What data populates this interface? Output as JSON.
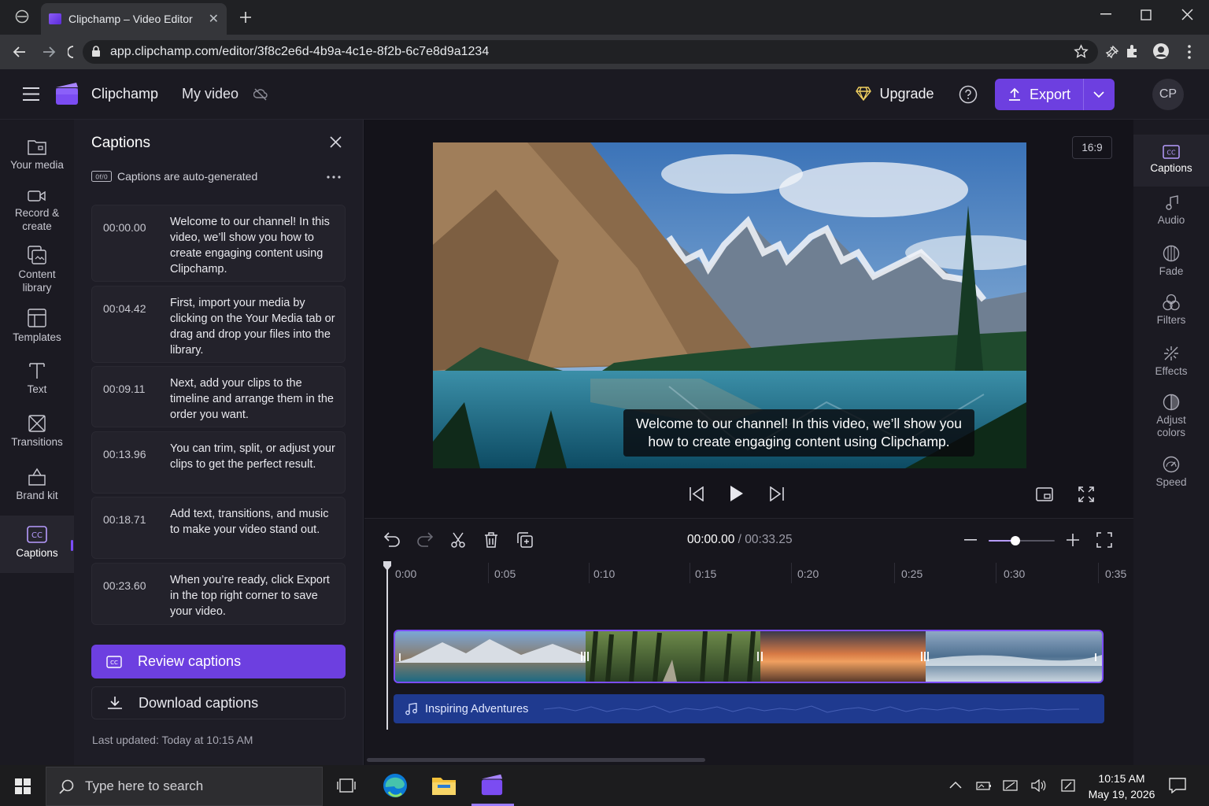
{
  "browser": {
    "tab_title": "Clipchamp – Video Editor",
    "url": "app.clipchamp.com/editor/3f8c2e6d-4b9a-4c1e-8f2b-6c7e8d9a1234"
  },
  "header": {
    "app_name": "Clipchamp",
    "project_name": "My video",
    "upgrade_label": "Upgrade",
    "export_label": "Export",
    "avatar_initials": "CP"
  },
  "left_nav": {
    "items": [
      {
        "label": "Your media"
      },
      {
        "label": "Record & create"
      },
      {
        "label": "Content library"
      },
      {
        "label": "Templates"
      },
      {
        "label": "Text"
      },
      {
        "label": "Transitions"
      },
      {
        "label": "Brand kit"
      },
      {
        "label": "Captions"
      }
    ]
  },
  "captions_panel": {
    "title": "Captions",
    "auto_note": "Captions are auto-generated",
    "cards": [
      {
        "time": "00:00.00",
        "text": "Welcome to our channel! In this video, we’ll show you how to create engaging content using Clipchamp."
      },
      {
        "time": "00:04.42",
        "text": "First, import your media by clicking on the Your Media tab or drag and drop your files into the library."
      },
      {
        "time": "00:09.11",
        "text": "Next, add your clips to the timeline and arrange them in the order you want."
      },
      {
        "time": "00:13.96",
        "text": "You can trim, split, or adjust your clips to get the perfect result."
      },
      {
        "time": "00:18.71",
        "text": "Add text, transitions, and music to make your video stand out."
      },
      {
        "time": "00:23.60",
        "text": "When you’re ready, click Export in the top right corner to save your video."
      }
    ],
    "review_label": "Review captions",
    "download_label": "Download captions",
    "last_updated": "Last updated: Today at 10:15 AM"
  },
  "preview": {
    "aspect_ratio": "16:9",
    "subtitle": "Welcome to our channel! In this video, we’ll show you how to create engaging content using Clipchamp."
  },
  "timeline": {
    "current_time": "00:00.00",
    "total_time": "/ 00:33.25",
    "ticks": [
      "0:00",
      "0:05",
      "0:10",
      "0:15",
      "0:20",
      "0:25",
      "0:30",
      "0:35"
    ],
    "zoom_level": 0.4,
    "audio_track_label": "Inspiring Adventures"
  },
  "right_panel": {
    "items": [
      {
        "label": "Captions"
      },
      {
        "label": "Audio"
      },
      {
        "label": "Fade"
      },
      {
        "label": "Filters"
      },
      {
        "label": "Effects"
      },
      {
        "label": "Adjust colors"
      },
      {
        "label": "Speed"
      }
    ]
  },
  "taskbar": {
    "search_placeholder": "Type here to search",
    "time": "10:15 AM",
    "date": "May 19, 2026"
  },
  "colors": {
    "accent": "#6d3fe0",
    "panel": "#1e1d26",
    "audio_track": "#1f3a8f"
  }
}
